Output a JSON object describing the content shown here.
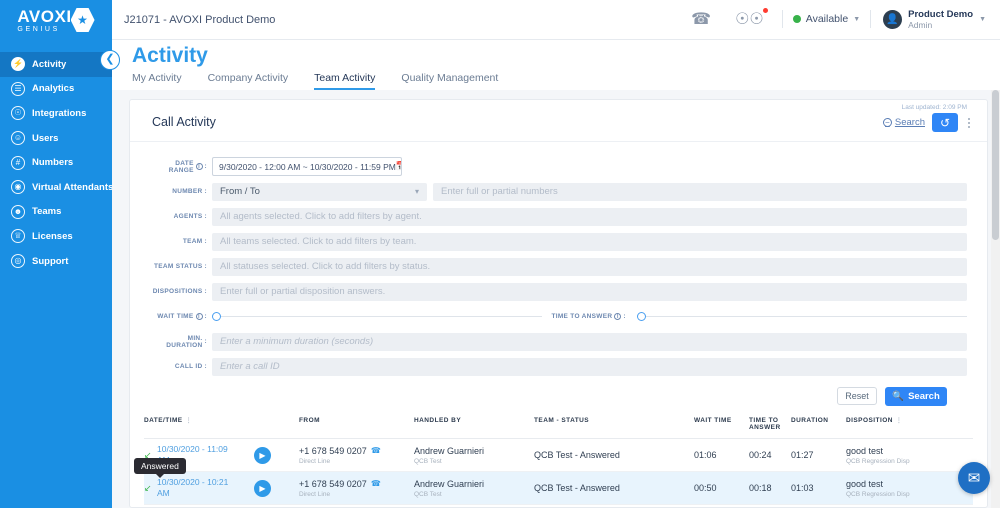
{
  "brand": {
    "name": "AVOXI",
    "sub": "GENIUS",
    "accent": "#1a8fe3"
  },
  "topbar": {
    "account": "J21071 - AVOXI Product Demo",
    "call_icon": "phone-forward-icon",
    "voicemail_icon": "voicemail-icon",
    "availability": "Available",
    "profile_name": "Product Demo",
    "profile_role": "Admin"
  },
  "sidebar": {
    "items": [
      {
        "label": "Activity",
        "icon": "bolt-icon",
        "active": true
      },
      {
        "label": "Analytics",
        "icon": "bar-chart-icon",
        "active": false
      },
      {
        "label": "Integrations",
        "icon": "plug-icon",
        "active": false
      },
      {
        "label": "Users",
        "icon": "user-icon",
        "active": false
      },
      {
        "label": "Numbers",
        "icon": "hash-icon",
        "active": false
      },
      {
        "label": "Virtual Attendants",
        "icon": "robot-icon",
        "active": false
      },
      {
        "label": "Teams",
        "icon": "people-icon",
        "active": false
      },
      {
        "label": "Licenses",
        "icon": "certificate-icon",
        "active": false
      },
      {
        "label": "Support",
        "icon": "lifebuoy-icon",
        "active": false
      }
    ]
  },
  "page": {
    "title": "Activity",
    "tabs": [
      {
        "label": "My Activity",
        "active": false
      },
      {
        "label": "Company Activity",
        "active": false
      },
      {
        "label": "Team Activity",
        "active": true
      },
      {
        "label": "Quality Management",
        "active": false
      }
    ]
  },
  "card": {
    "title": "Call Activity",
    "last_updated": "Last updated: 2:09 PM",
    "search_toggle": "Search",
    "refresh_icon": "refresh-icon",
    "menu_icon": "kebab-menu-icon"
  },
  "filters": {
    "date_range": {
      "label": "DATE RANGE",
      "value": "9/30/2020 - 12:00 AM ~ 10/30/2020 - 11:59 PM",
      "calendar_icon": "calendar-icon"
    },
    "number": {
      "label": "NUMBER",
      "select_value": "From / To",
      "input_placeholder": "Enter full or partial numbers"
    },
    "agents": {
      "label": "AGENTS",
      "placeholder": "All agents selected. Click to add filters by agent."
    },
    "team": {
      "label": "TEAM",
      "placeholder": "All teams selected. Click to add filters by team."
    },
    "team_status": {
      "label": "TEAM STATUS",
      "placeholder": "All statuses selected. Click to add filters by status."
    },
    "dispositions": {
      "label": "DISPOSITIONS",
      "placeholder": "Enter full or partial disposition answers."
    },
    "wait_time": {
      "label": "WAIT TIME"
    },
    "time_to_answer": {
      "label": "TIME TO ANSWER"
    },
    "min_duration": {
      "label": "MIN. DURATION",
      "placeholder": "Enter a minimum duration (seconds)"
    },
    "call_id": {
      "label": "CALL ID",
      "placeholder": "Enter a call ID"
    },
    "reset_label": "Reset",
    "search_label": "Search",
    "search_icon": "search-icon"
  },
  "table": {
    "columns": [
      {
        "label": "DATE/TIME",
        "sortable": true
      },
      {
        "label": "FROM",
        "sortable": false
      },
      {
        "label": "HANDLED BY",
        "sortable": false
      },
      {
        "label": "TEAM - STATUS",
        "sortable": false
      },
      {
        "label": "WAIT TIME",
        "sortable": false
      },
      {
        "label": "TIME TO ANSWER",
        "sortable": false
      },
      {
        "label": "DURATION",
        "sortable": false
      },
      {
        "label": "DISPOSITION",
        "sortable": true
      }
    ],
    "rows": [
      {
        "datetime": "10/30/2020 - 11:09 AM",
        "direction_icon": "inbound-call-icon",
        "play_icon": "play-icon",
        "from_number": "+1 678 549 0207",
        "from_sub": "Direct Line",
        "handled_by": "Andrew Guarnieri",
        "handled_by_sub": "QCB Test",
        "team_status": "QCB Test - Answered",
        "wait_time": "01:06",
        "time_to_answer": "00:24",
        "duration": "01:27",
        "disposition": "good test",
        "disposition_sub": "QCB Regression Disp",
        "hovered": false
      },
      {
        "datetime": "10/30/2020 - 10:21 AM",
        "direction_icon": "inbound-call-icon",
        "play_icon": "play-icon",
        "from_number": "+1 678 549 0207",
        "from_sub": "Direct Line",
        "handled_by": "Andrew Guarnieri",
        "handled_by_sub": "QCB Test",
        "team_status": "QCB Test - Answered",
        "wait_time": "00:50",
        "time_to_answer": "00:18",
        "duration": "01:03",
        "disposition": "good test",
        "disposition_sub": "QCB Regression Disp",
        "hovered": true
      }
    ]
  },
  "tooltip": {
    "text": "Answered"
  },
  "chat": {
    "icon": "envelope-icon"
  }
}
